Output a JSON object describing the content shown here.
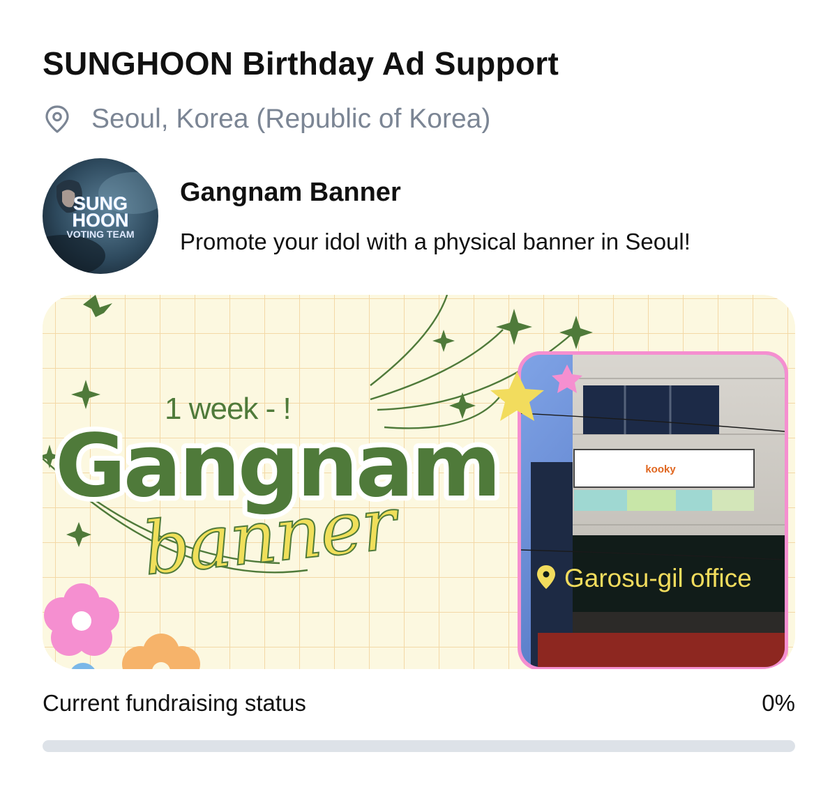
{
  "header": {
    "title": "SUNGHOON Birthday Ad Support",
    "location": "Seoul, Korea (Republic of Korea)",
    "location_icon": "map-pin-icon"
  },
  "campaign": {
    "name": "Gangnam Banner",
    "description": "Promote your idol with a physical banner in Seoul!",
    "avatar": {
      "line1": "SUNG",
      "line2": "HOON",
      "line3": "VOTING TEAM"
    }
  },
  "banner_image": {
    "tagline": "1 week - !",
    "headline": "Gangnam",
    "script_word": "banner",
    "sign_text": "kooky",
    "location_label": "Garosu-gil office",
    "colors": {
      "background": "#fcf8e0",
      "grid": "#f3d8a6",
      "green": "#4f7a3a",
      "yellow": "#f0df5a",
      "pink": "#f58fd0",
      "orange": "#f6b36a"
    }
  },
  "fundraising": {
    "label": "Current fundraising status",
    "percent_text": "0%",
    "progress": 0
  }
}
